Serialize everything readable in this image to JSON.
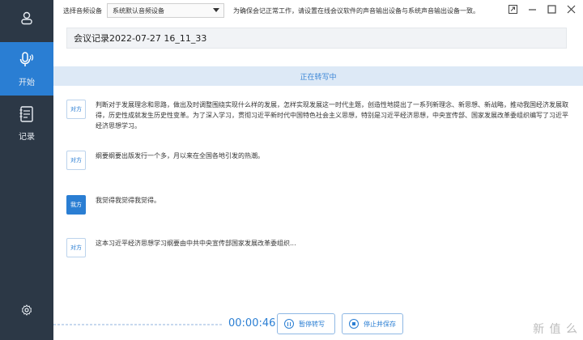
{
  "colors": {
    "accent": "#2a7ed3",
    "sidebar_bg": "#2c3846",
    "banner_bg": "#dde9f6"
  },
  "sidebar": {
    "avatar_icon": "user-icon",
    "items": [
      {
        "label": "开始",
        "icon": "microphone-icon",
        "active": true
      },
      {
        "label": "记录",
        "icon": "notebook-icon",
        "active": false
      }
    ],
    "settings_icon": "gear-icon"
  },
  "topbar": {
    "device_label": "选择音频设备",
    "device_value": "系统默认音频设备",
    "hint": "为确保会记正常工作，请设置在线会议软件的声音输出设备与系统声音输出设备一致。",
    "window_controls": [
      "share-icon",
      "minimize-icon",
      "maximize-icon",
      "close-icon"
    ]
  },
  "meeting": {
    "title": "会议记录2022-07-27 16_11_33"
  },
  "status": {
    "text": "正在转写中"
  },
  "transcript": [
    {
      "speaker": "对方",
      "self": false,
      "text": "判断对于发展理念和思路，做出及时调整围绕实现什么样的发展，怎样实现发展这一时代主题，创造性地提出了一系列新理念、新思想、新战略，推动我国经济发展取得，历史性成就发生历史性变革。为了深入学习，贯彻习近平新时代中国特色社会主义思想，特别是习近平经济思想，中央宣传部、国家发展改革委组织编写了习近平经济思想学习。"
    },
    {
      "speaker": "对方",
      "self": false,
      "text": "纲要纲要出版发行一个多，月以来在全国各地引发的热潮。"
    },
    {
      "speaker": "我方",
      "self": true,
      "text": "我觉得我觉得我觉得。"
    },
    {
      "speaker": "对方",
      "self": false,
      "text": "这本习近平经济思想学习纲要由中共中央宣传部国家发展改革委组织..."
    }
  ],
  "controls": {
    "timer": "00:00:46",
    "pause_label": "暂停转写",
    "stop_label": "停止并保存"
  },
  "watermark": "新 值 么"
}
